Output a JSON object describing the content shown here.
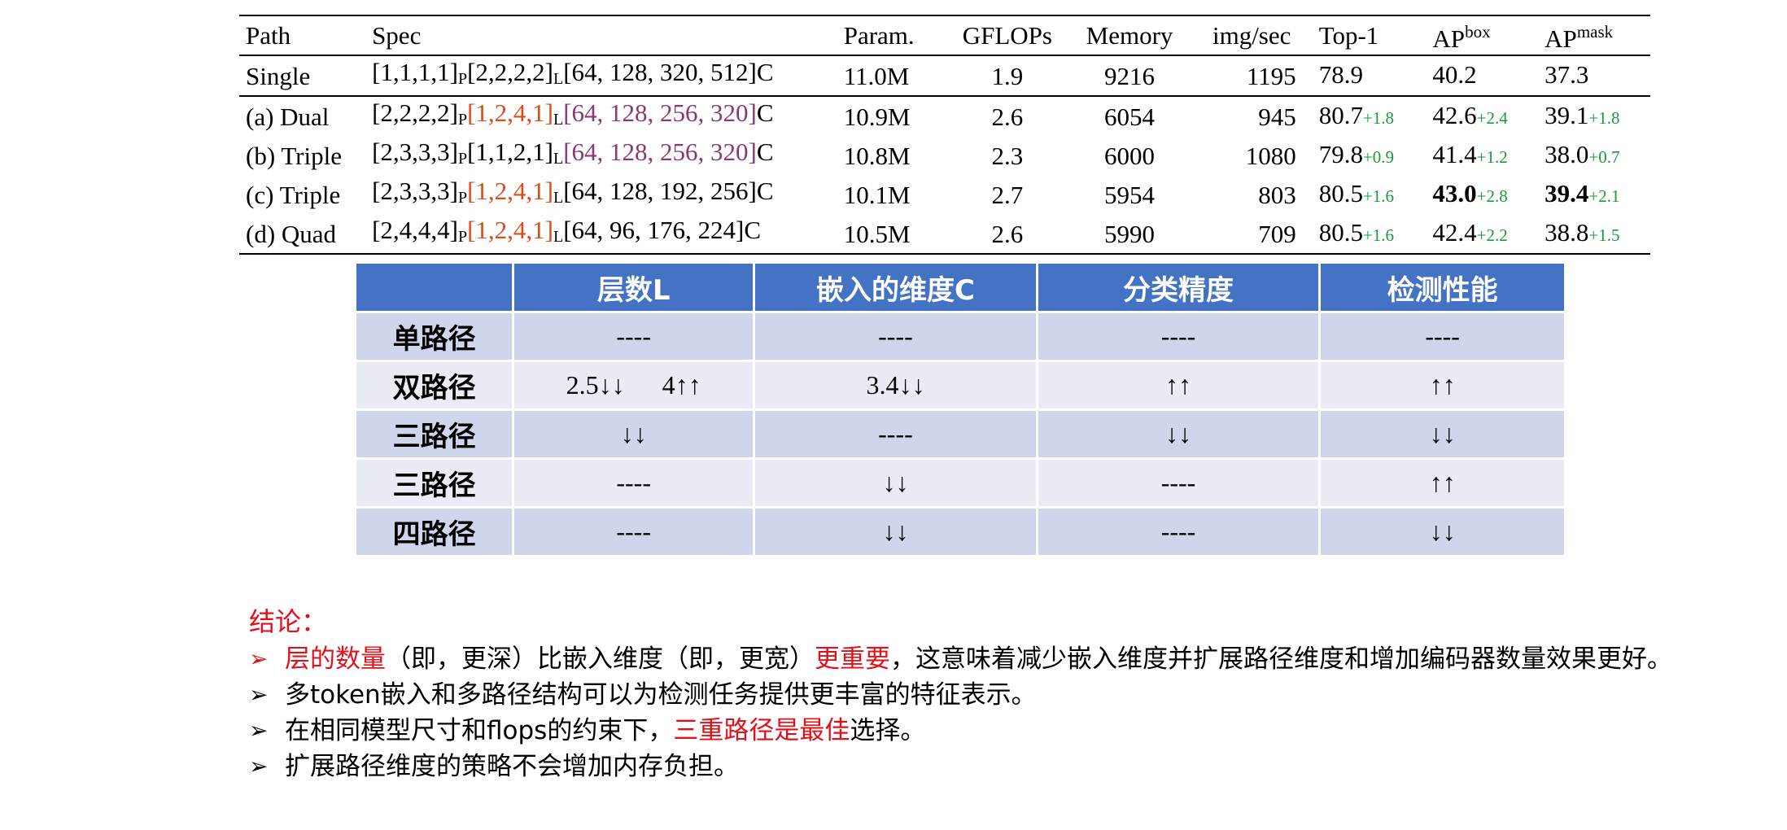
{
  "results_table": {
    "headers": {
      "path": "Path",
      "spec": "Spec",
      "param": "Param.",
      "gflops": "GFLOPs",
      "memory": "Memory",
      "imgsec": "img/sec",
      "top1": "Top-1",
      "apbox_base": "AP",
      "apbox_sup": "box",
      "apmask_base": "AP",
      "apmask_sup": "mask"
    },
    "rows": [
      {
        "path": "Single",
        "p": "[1,1,1,1]",
        "p_tag": "P",
        "l": "[2,2,2,2]",
        "l_tag": "L",
        "c": "[64, 128, 320, 512]",
        "c_tag": "C",
        "param": "11.0M",
        "gflops": "1.9",
        "memory": "9216",
        "imgsec": "1195",
        "top1": "78.9",
        "top1_d": "",
        "apbox": "40.2",
        "apbox_d": "",
        "apmask": "37.3",
        "apmask_d": ""
      },
      {
        "path": "(a) Dual",
        "p": "[2,2,2,2]",
        "p_tag": "P",
        "l": "[1,2,4,1]",
        "l_tag": "L",
        "c": "[64, 128, 256, 320]",
        "c_tag": "C",
        "param": "10.9M",
        "gflops": "2.6",
        "memory": "6054",
        "imgsec": "945",
        "top1": "80.7",
        "top1_d": "+1.8",
        "apbox": "42.6",
        "apbox_d": "+2.4",
        "apmask": "39.1",
        "apmask_d": "+1.8"
      },
      {
        "path": "(b) Triple",
        "p": "[2,3,3,3]",
        "p_tag": "P",
        "l": "[1,1,2,1]",
        "l_tag": "L",
        "c": "[64, 128, 256, 320]",
        "c_tag": "C",
        "param": "10.8M",
        "gflops": "2.3",
        "memory": "6000",
        "imgsec": "1080",
        "top1": "79.8",
        "top1_d": "+0.9",
        "apbox": "41.4",
        "apbox_d": "+1.2",
        "apmask": "38.0",
        "apmask_d": "+0.7"
      },
      {
        "path": "(c) Triple",
        "p": "[2,3,3,3]",
        "p_tag": "P",
        "l": "[1,2,4,1]",
        "l_tag": "L",
        "c": "[64, 128, 192, 256]",
        "c_tag": "C",
        "param": "10.1M",
        "gflops": "2.7",
        "memory": "5954",
        "imgsec": "803",
        "top1": "80.5",
        "top1_d": "+1.6",
        "apbox": "43.0",
        "apbox_d": "+2.8",
        "apmask": "39.4",
        "apmask_d": "+2.1"
      },
      {
        "path": "(d) Quad",
        "p": "[2,4,4,4]",
        "p_tag": "P",
        "l": "[1,2,4,1]",
        "l_tag": "L",
        "c": "[64,   96, 176, 224]",
        "c_tag": "C",
        "param": "10.5M",
        "gflops": "2.6",
        "memory": "5990",
        "imgsec": "709",
        "top1": "80.5",
        "top1_d": "+1.6",
        "apbox": "42.4",
        "apbox_d": "+2.2",
        "apmask": "38.8",
        "apmask_d": "+1.5"
      }
    ],
    "colors": {
      "delta": "#1a9a3a",
      "l_highlight": "#e0491a",
      "c_highlight": "#8a3a72"
    }
  },
  "cn_table": {
    "headers": [
      "",
      "层数L",
      "嵌入的维度C",
      "分类精度",
      "检测性能"
    ],
    "rows": [
      {
        "name": "单路径",
        "layers_a": "----",
        "layers_b": "",
        "embed": "----",
        "cls": "----",
        "det": "----"
      },
      {
        "name": "双路径",
        "layers_a": "2.5↓↓",
        "layers_b": "4↑↑",
        "embed": "3.4↓↓",
        "cls": "↑↑",
        "det": "↑↑"
      },
      {
        "name": "三路径",
        "layers_a": "↓↓",
        "layers_b": "",
        "embed": "----",
        "cls": "↓↓",
        "det": "↓↓"
      },
      {
        "name": "三路径",
        "layers_a": "----",
        "layers_b": "",
        "embed": "↓↓",
        "cls": "----",
        "det": "↑↑"
      },
      {
        "name": "四路径",
        "layers_a": "----",
        "layers_b": "",
        "embed": "↓↓",
        "cls": "----",
        "det": "↓↓"
      }
    ],
    "colors": {
      "header_bg": "#4472c4",
      "row_dark": "#cfd5ea",
      "row_light": "#e9ebf5"
    }
  },
  "conclusion": {
    "heading": "结论：",
    "marker": "➢",
    "b1_hl1": "层的数量",
    "b1_t1": "（即，更深）比嵌入维度（即，更宽）",
    "b1_hl2": "更重要",
    "b1_t2": "，这意味着减少嵌入维度并扩展路径维度和增加编码器数量效果更好。",
    "b2": "多token嵌入和多路径结构可以为检测任务提供更丰富的特征表示。",
    "b3_t1": "在相同模型尺寸和flops的约束下，",
    "b3_hl": "三重路径是最佳",
    "b3_t2": "选择。",
    "b4": "扩展路径维度的策略不会增加内存负担。",
    "colors": {
      "highlight": "#e3101a"
    }
  }
}
